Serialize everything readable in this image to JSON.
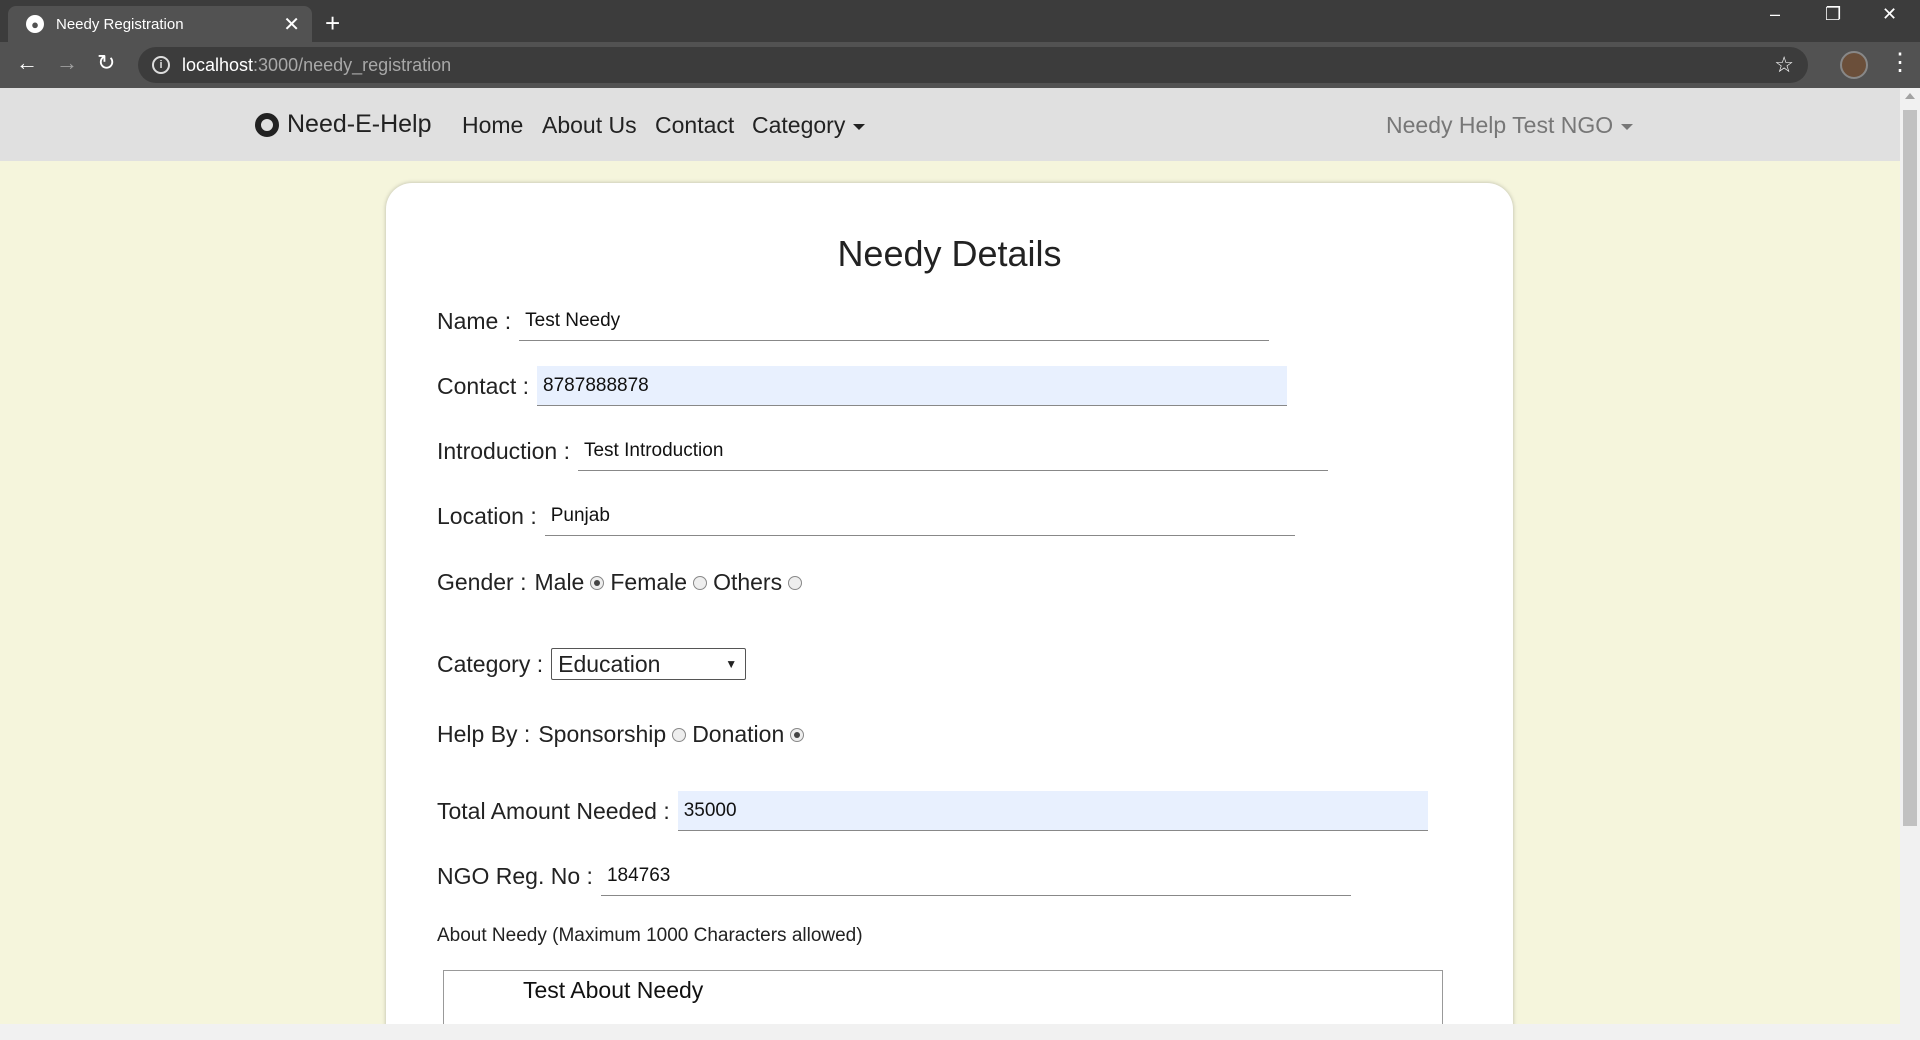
{
  "browser": {
    "tab_title": "Needy Registration",
    "url_host": "localhost",
    "url_path": ":3000/needy_registration"
  },
  "nav": {
    "brand": "Need-E-Help",
    "links": [
      "Home",
      "About Us",
      "Contact",
      "Category"
    ],
    "account": "Needy Help Test NGO"
  },
  "form": {
    "title": "Needy Details",
    "name_label": "Name :",
    "name_value": "Test Needy",
    "contact_label": "Contact :",
    "contact_value": "8787888878",
    "intro_label": "Introduction :",
    "intro_value": "Test Introduction",
    "location_label": "Location :",
    "location_value": "Punjab",
    "gender_label": "Gender :",
    "gender_options": [
      "Male",
      "Female",
      "Others"
    ],
    "gender_selected": "Male",
    "category_label": "Category :",
    "category_value": "Education",
    "helpby_label": "Help By :",
    "helpby_options": [
      "Sponsorship",
      "Donation"
    ],
    "helpby_selected": "Donation",
    "amount_label": "Total Amount Needed :",
    "amount_value": "35000",
    "ngo_label": "NGO Reg. No :",
    "ngo_value": "184763",
    "about_label": "About Needy (Maximum 1000 Characters allowed)",
    "about_value": "Test About Needy"
  }
}
